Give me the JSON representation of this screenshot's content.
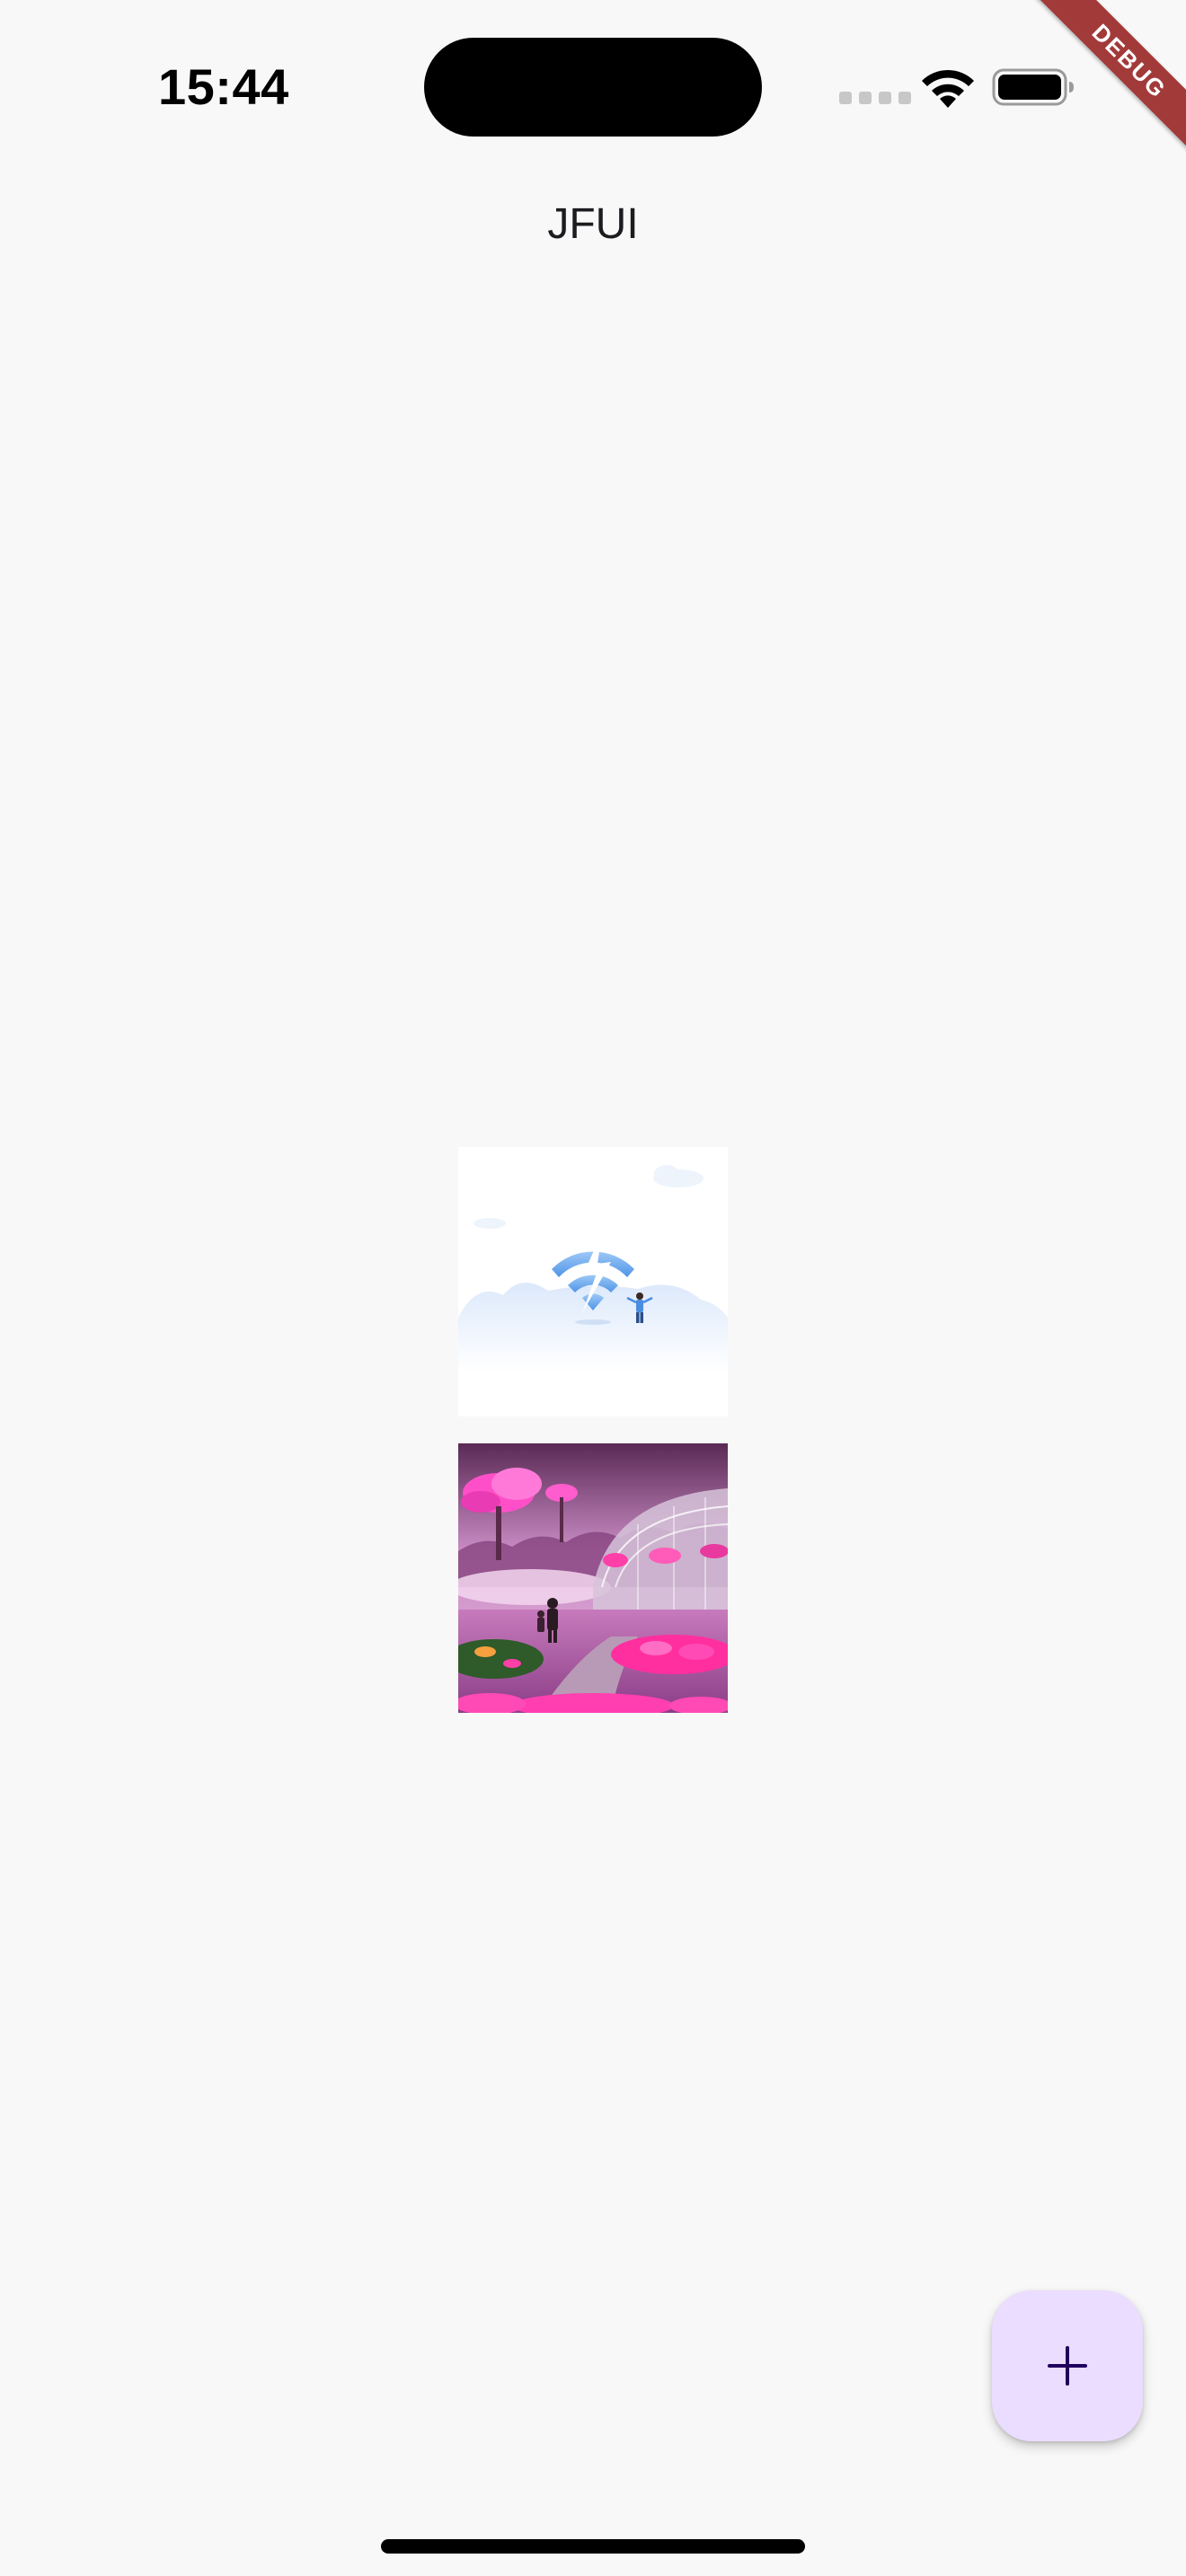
{
  "status_bar": {
    "time": "15:44",
    "icons": [
      "signal-dots-icon",
      "wifi-icon",
      "battery-icon"
    ]
  },
  "debug_banner": {
    "label": "DEBUG"
  },
  "app_bar": {
    "title": "JFUI"
  },
  "images": [
    {
      "name": "no-wifi-illustration",
      "description": "broken wifi illustration"
    },
    {
      "name": "pink-fantasy-garden",
      "description": "pink garden scene"
    }
  ],
  "fab": {
    "icon": "plus-icon"
  },
  "colors": {
    "background": "#f8f8f8",
    "fab_background": "#eaddff",
    "debug_ribbon": "#a23a3a",
    "title_text": "#1c1b1f"
  }
}
